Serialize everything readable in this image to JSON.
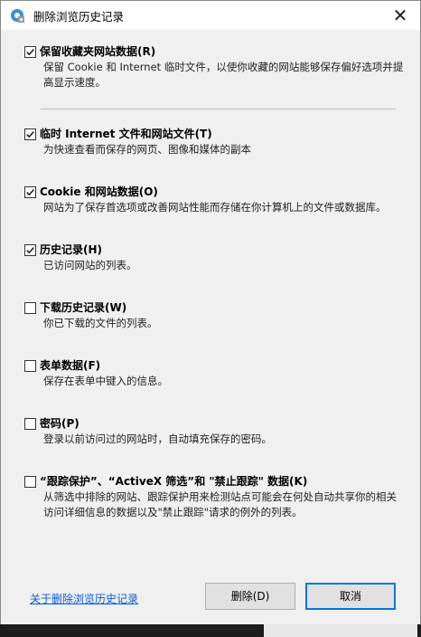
{
  "window": {
    "title": "删除浏览历史记录",
    "close_symbol": "✕",
    "icon": "ie-settings-icon"
  },
  "options": [
    {
      "label": "保留收藏夹网站数据(R)",
      "desc": "保留 Cookie 和 Internet 临时文件，以使你收藏的网站能够保存偏好选项并提高显示速度。",
      "checked": true
    },
    {
      "label": "临时 Internet 文件和网站文件(T)",
      "desc": "为快速查看而保存的网页、图像和媒体的副本",
      "checked": true
    },
    {
      "label": "Cookie 和网站数据(O)",
      "desc": "网站为了保存首选项或改善网站性能而存储在你计算机上的文件或数据库。",
      "checked": true
    },
    {
      "label": "历史记录(H)",
      "desc": "已访问网站的列表。",
      "checked": true
    },
    {
      "label": "下载历史记录(W)",
      "desc": "你已下载的文件的列表。",
      "checked": false
    },
    {
      "label": "表单数据(F)",
      "desc": "保存在表单中键入的信息。",
      "checked": false
    },
    {
      "label": "密码(P)",
      "desc": "登录以前访问过的网站时，自动填充保存的密码。",
      "checked": false
    },
    {
      "label": "“跟踪保护”、“ActiveX 筛选”和 \"禁止跟踪\" 数据(K)",
      "desc": "从筛选中排除的网站、跟踪保护用来检测站点可能会在何处自动共享你的相关访问详细信息的数据以及\"禁止跟踪\"请求的例外的列表。",
      "checked": false
    }
  ],
  "footer": {
    "link": "关于删除浏览历史记录",
    "delete_label": "删除(D)",
    "cancel_label": "取消"
  },
  "colors": {
    "link": "#0b5bd6",
    "accent": "#0078d7"
  }
}
